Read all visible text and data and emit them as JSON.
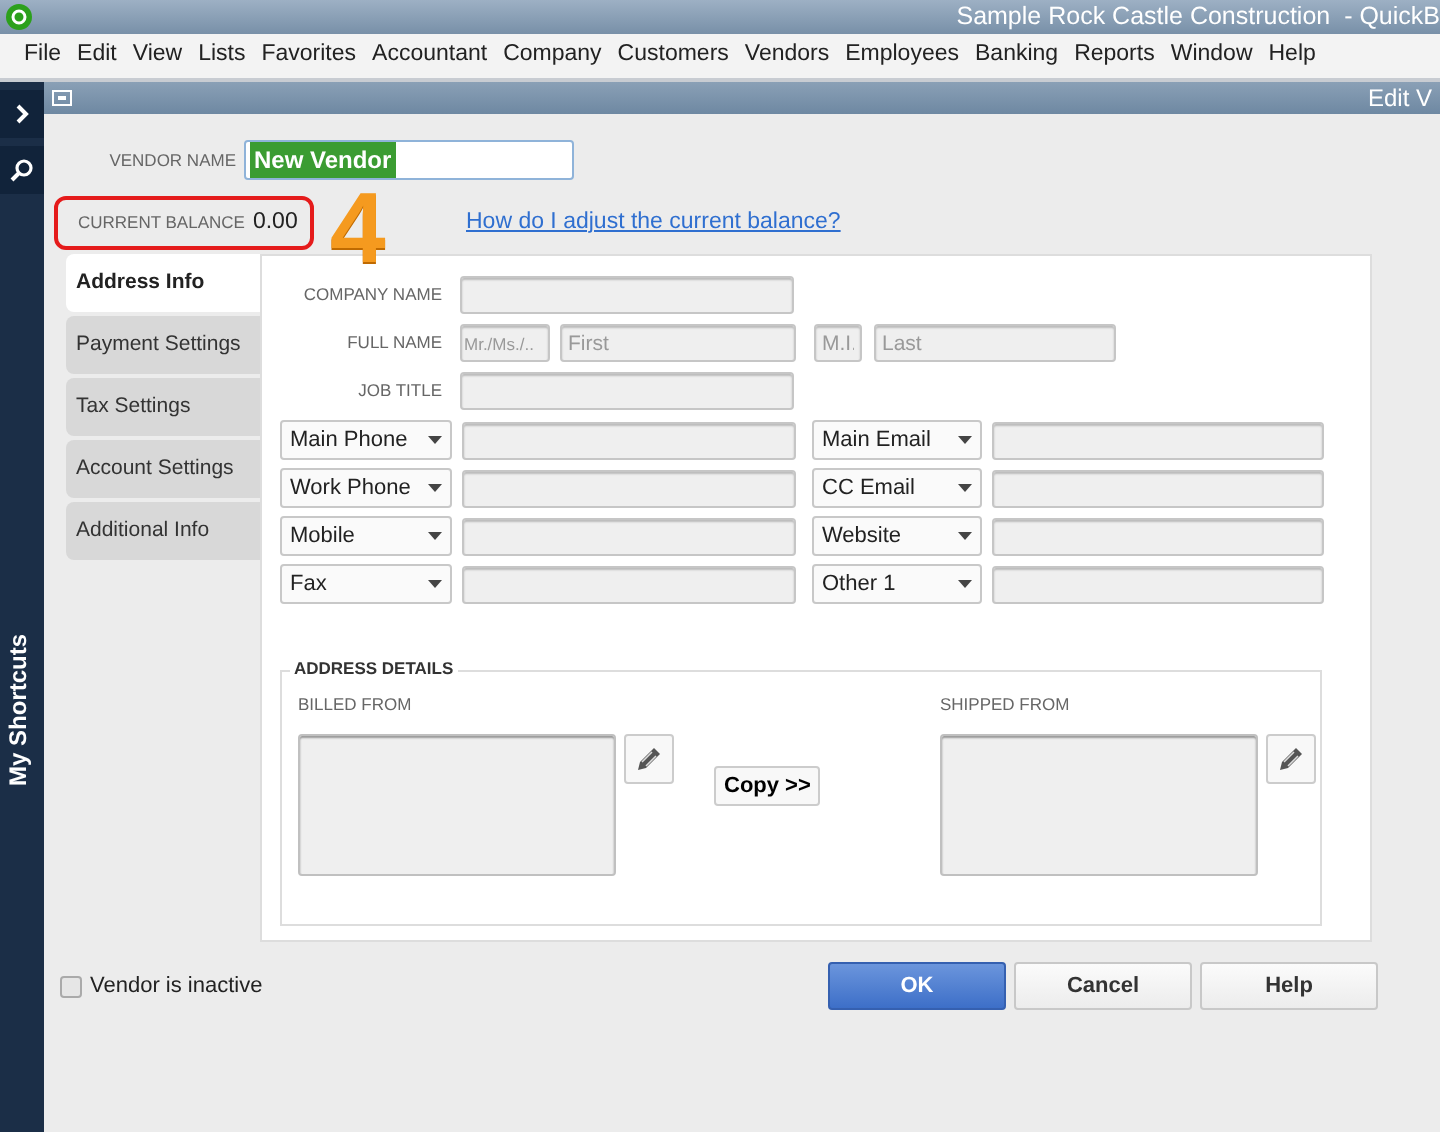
{
  "app": {
    "title": "Sample Rock Castle Construction  - QuickB"
  },
  "menu": [
    {
      "label": "File"
    },
    {
      "label": "Edit"
    },
    {
      "label": "View"
    },
    {
      "label": "Lists"
    },
    {
      "label": "Favorites"
    },
    {
      "label": "Accountant"
    },
    {
      "label": "Company"
    },
    {
      "label": "Customers"
    },
    {
      "label": "Vendors"
    },
    {
      "label": "Employees"
    },
    {
      "label": "Banking"
    },
    {
      "label": "Reports"
    },
    {
      "label": "Window"
    },
    {
      "label": "Help"
    }
  ],
  "sidebar": {
    "label": "My Shortcuts"
  },
  "window": {
    "title": "Edit V"
  },
  "form": {
    "vendor_name": {
      "label": "VENDOR NAME",
      "value": "New Vendor",
      "selected": true
    },
    "current_balance": {
      "label": "CURRENT BALANCE",
      "value": "0.00",
      "highlighted": true
    },
    "annotation": "4",
    "help_link": "How do I adjust the current balance?",
    "tabs": [
      {
        "label": "Address Info",
        "selected": true
      },
      {
        "label": "Payment Settings",
        "selected": false
      },
      {
        "label": "Tax Settings",
        "selected": false
      },
      {
        "label": "Account Settings",
        "selected": false
      },
      {
        "label": "Additional Info",
        "selected": false
      }
    ],
    "company_name": {
      "label": "COMPANY NAME"
    },
    "full_name": {
      "label": "FULL NAME",
      "placeholders": [
        "Mr./Ms./..",
        "First",
        "M.I.",
        "Last"
      ]
    },
    "job_title": {
      "label": "JOB TITLE"
    },
    "contact_rows": [
      {
        "left": "Main Phone",
        "right": "Main Email"
      },
      {
        "left": "Work Phone",
        "right": "CC Email"
      },
      {
        "left": "Mobile",
        "right": "Website"
      },
      {
        "left": "Fax",
        "right": "Other 1"
      }
    ],
    "address_details": {
      "title": "ADDRESS DETAILS",
      "billed_from": "BILLED FROM",
      "shipped_from": "SHIPPED FROM",
      "copy_button": "Copy >>"
    },
    "inactive": {
      "label": "Vendor is inactive",
      "checked": false
    },
    "buttons": [
      {
        "label": "OK",
        "primary": true
      },
      {
        "label": "Cancel",
        "primary": false
      },
      {
        "label": "Help",
        "primary": false
      }
    ]
  }
}
